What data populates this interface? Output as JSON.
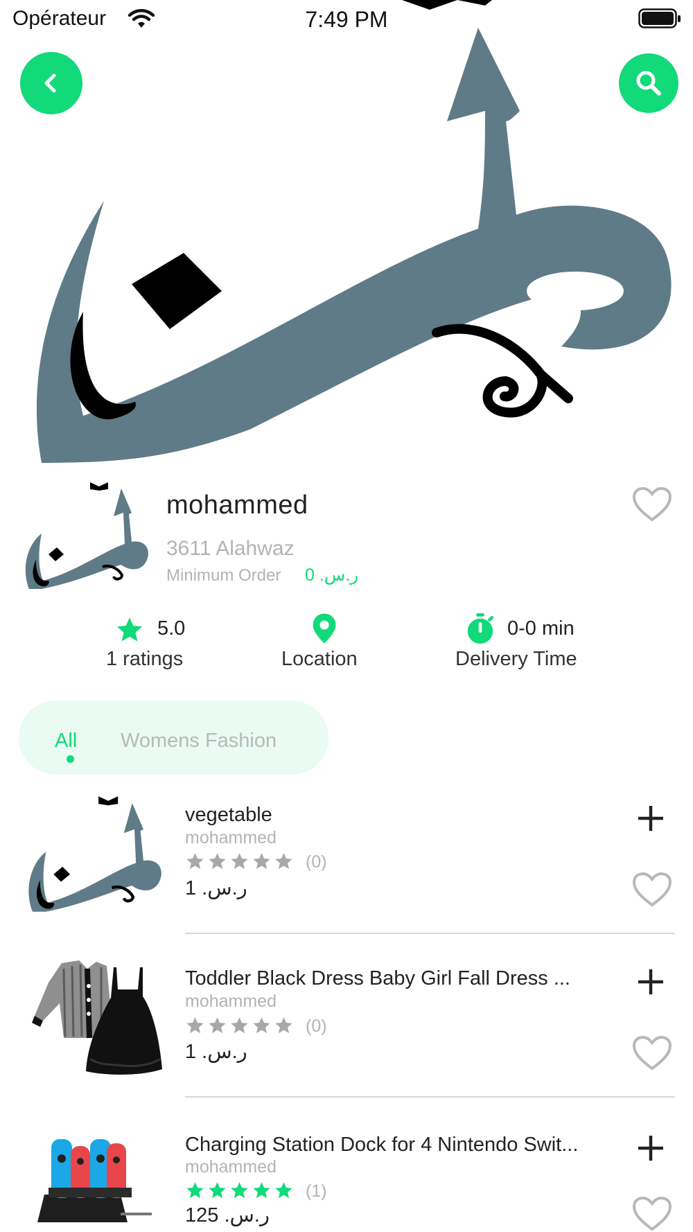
{
  "status_bar": {
    "carrier": "Opérateur",
    "time": "7:49 PM"
  },
  "colors": {
    "accent": "#12d97a",
    "muted_text": "#b3b3b3",
    "tab_bg": "#e9fbf2",
    "logo_slate": "#5f7b87"
  },
  "header": {
    "back_icon": "chevron-left-icon",
    "search_icon": "search-icon"
  },
  "store": {
    "name": "mohammed",
    "address": "3611 Alahwaz",
    "min_order_label": "Minimum Order",
    "min_order_value": "0 .ر.س"
  },
  "stats": {
    "rating_value": "5.0",
    "rating_label": "1 ratings",
    "location_label": "Location",
    "delivery_value": "0-0 min",
    "delivery_label": "Delivery Time"
  },
  "tabs": {
    "items": [
      {
        "label": "All",
        "selected": true
      },
      {
        "label": "Womens Fashion",
        "selected": false
      }
    ]
  },
  "products": [
    {
      "name": "vegetable",
      "seller": "mohammed",
      "rating": 0,
      "rating_count": "(0)",
      "price": "1 .ر.س"
    },
    {
      "name": "Toddler Black Dress Baby Girl Fall Dress ...",
      "seller": "mohammed",
      "rating": 0,
      "rating_count": "(0)",
      "price": "1 .ر.س"
    },
    {
      "name": "Charging Station Dock for 4 Nintendo Swit...",
      "seller": "mohammed",
      "rating": 5,
      "rating_count": "(1)",
      "price": "125 .ر.س"
    }
  ]
}
